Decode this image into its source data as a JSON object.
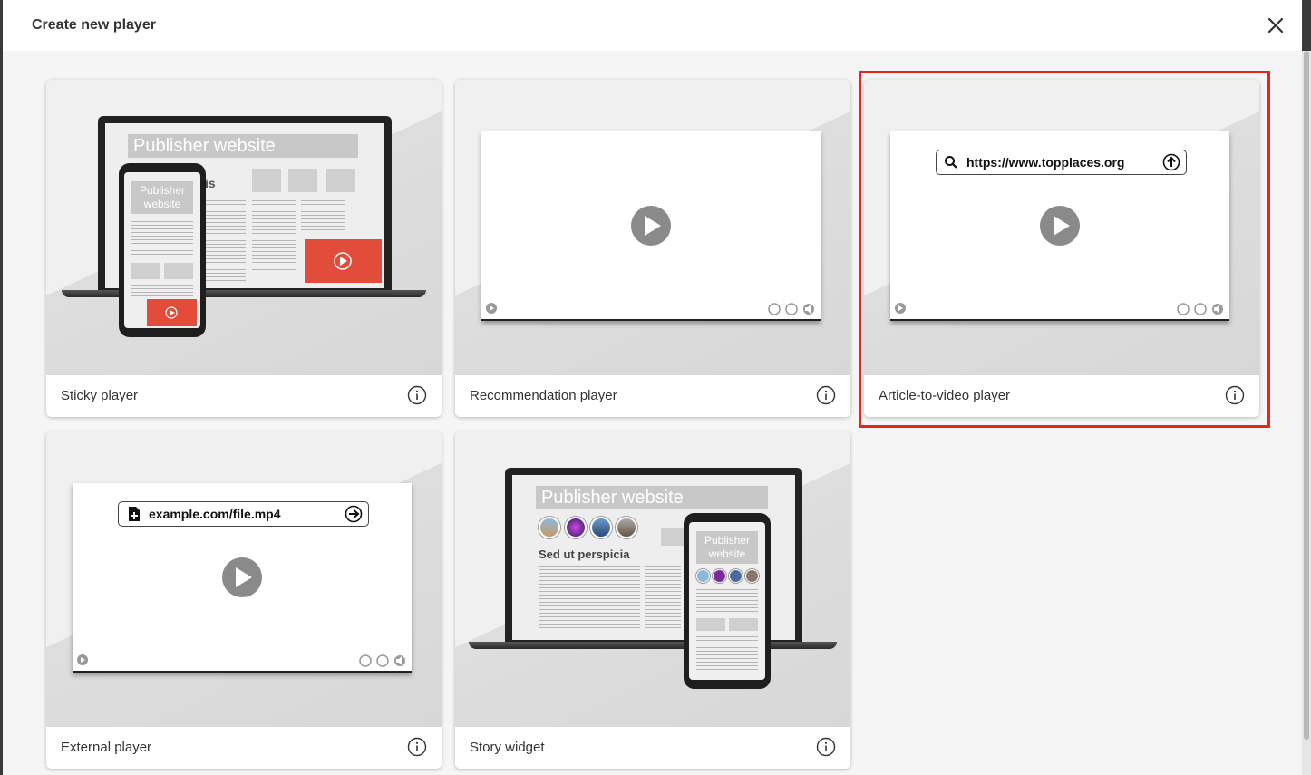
{
  "dialog": {
    "title": "Create new player",
    "close_icon": "close-icon"
  },
  "selected_card": "Article-to-video player",
  "colors": {
    "selection_border": "#e8261b",
    "accent_red": "#e24c3b"
  },
  "cards": [
    {
      "label": "Sticky player",
      "preview": {
        "publisher_title": "Publisher website",
        "phone_title": "Publisher website",
        "partial_text": "is"
      }
    },
    {
      "label": "Recommendation player"
    },
    {
      "label": "Article-to-video player",
      "preview": {
        "url": "https://www.topplaces.org"
      }
    },
    {
      "label": "External player",
      "preview": {
        "url": "example.com/file.mp4"
      }
    },
    {
      "label": "Story widget",
      "preview": {
        "publisher_title": "Publisher website",
        "phone_title": "Publisher website",
        "heading": "Sed ut perspicia"
      }
    }
  ]
}
